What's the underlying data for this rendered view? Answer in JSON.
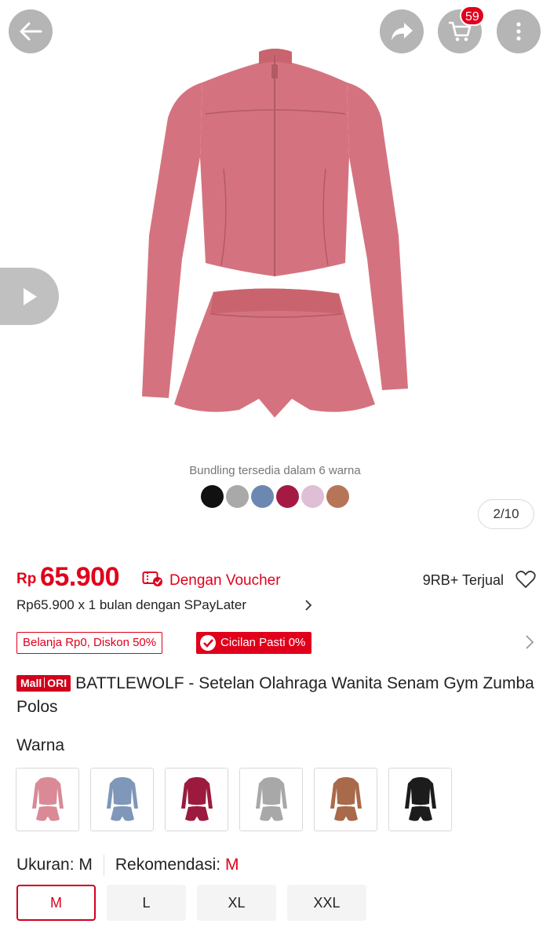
{
  "header": {
    "back_icon": "arrow-left-icon",
    "share_icon": "share-icon",
    "cart_icon": "cart-icon",
    "cart_count": "59",
    "more_icon": "more-vertical-icon"
  },
  "gallery": {
    "caption": "Bundling tersedia dalam 6 warna",
    "counter": "2/10",
    "swatch_colors": [
      "#111111",
      "#a9a9a9",
      "#6d88b0",
      "#a41a45",
      "#dfbfd6",
      "#b77557"
    ],
    "product_color": "#d4737f"
  },
  "price": {
    "currency": "Rp",
    "amount": "65.900",
    "voucher_text": "Dengan Voucher",
    "sold": "9RB+ Terjual",
    "spaylater": "Rp65.900 x 1 bulan dengan SPayLater"
  },
  "promos": {
    "discount": "Belanja Rp0, Diskon 50%",
    "cicilan": "Cicilan Pasti 0%"
  },
  "product": {
    "badge_mall": "Mall",
    "badge_ori": "ORI",
    "title": "BATTLEWOLF - Setelan Olahraga Wanita Senam Gym Zumba Polos"
  },
  "variants": {
    "label": "Warna",
    "colors": [
      "#d98a96",
      "#7f97b8",
      "#9c1a3e",
      "#a8a8a8",
      "#a86a4a",
      "#1c1c1c"
    ]
  },
  "size": {
    "label": "Ukuran:",
    "value": "M",
    "rec_label": "Rekomendasi:",
    "rec_value": "M",
    "options": [
      "M",
      "L",
      "XL",
      "XXL"
    ],
    "selected": "M"
  },
  "colors": {
    "accent": "#e0001b"
  }
}
